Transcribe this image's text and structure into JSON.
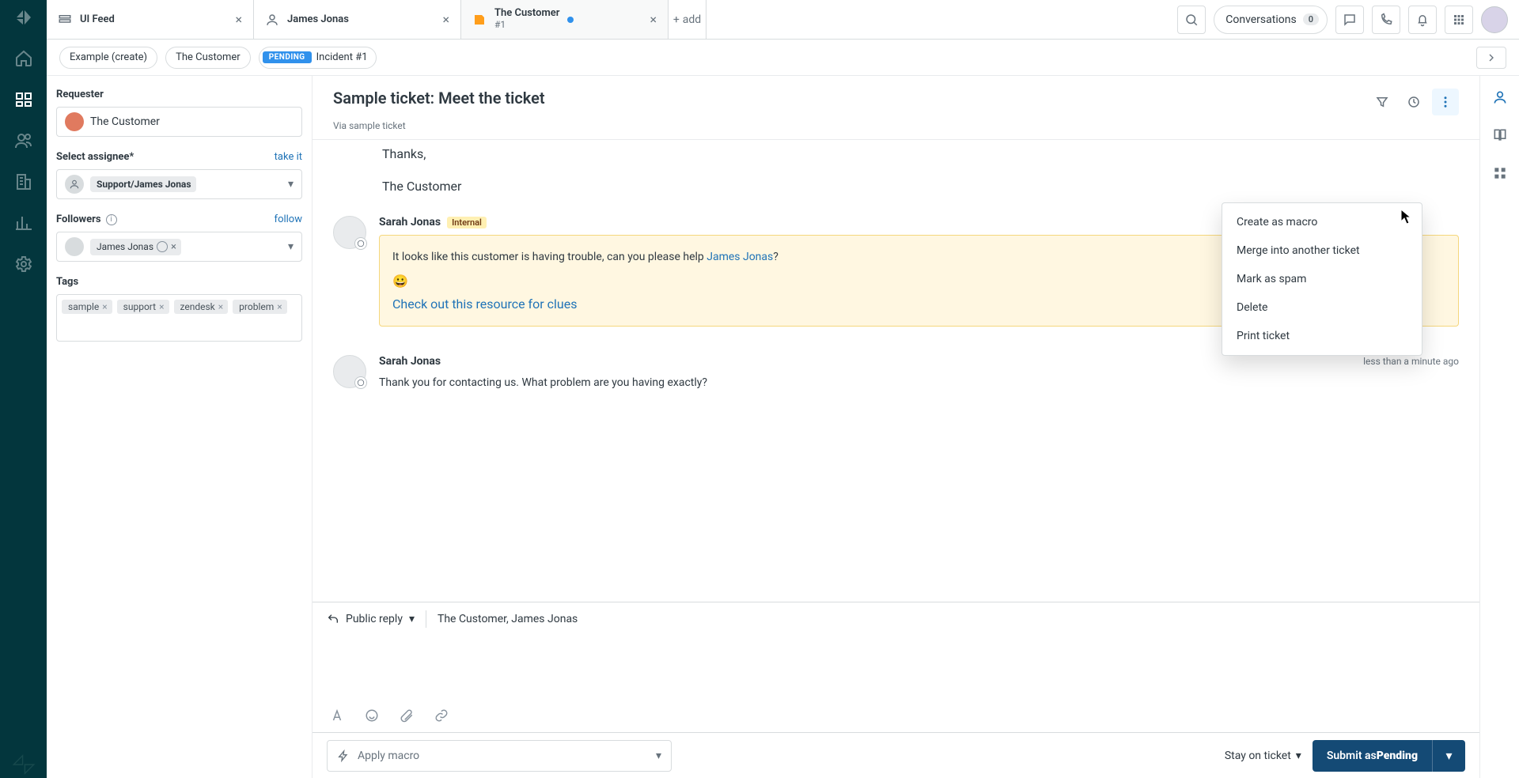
{
  "tabs": [
    {
      "icon": "views",
      "title": "UI Feed",
      "sub": ""
    },
    {
      "icon": "user",
      "title": "James Jonas",
      "sub": ""
    },
    {
      "icon": "ticket",
      "title": "The Customer",
      "sub": "#1",
      "dot": true
    }
  ],
  "add_label": "add",
  "topbar": {
    "conversations_label": "Conversations",
    "conversations_count": "0"
  },
  "breadcrumb": {
    "example": "Example (create)",
    "customer": "The Customer",
    "status_badge": "PENDING",
    "incident": "Incident #1"
  },
  "subject": "Sample ticket: Meet the ticket",
  "via": "Via sample ticket",
  "context_menu": [
    "Create as macro",
    "Merge into another ticket",
    "Mark as spam",
    "Delete",
    "Print ticket"
  ],
  "sidebar": {
    "requester_label": "Requester",
    "requester_name": "The Customer",
    "assignee_label": "Select assignee*",
    "take_it": "take it",
    "assignee_value": "Support/James Jonas",
    "followers_label": "Followers",
    "follow": "follow",
    "follower_chip": "James Jonas",
    "tags_label": "Tags",
    "tags": [
      "sample",
      "support",
      "zendesk",
      "problem"
    ]
  },
  "thread": {
    "prior": {
      "thanks": "Thanks,",
      "sig": "The Customer"
    },
    "msg1": {
      "author": "Sarah Jonas",
      "internal": "Internal",
      "body_pre": "It looks like this customer is having trouble, can you please help ",
      "body_link": "James Jonas",
      "body_post": "?",
      "emoji": "😀",
      "clue": "Check out this resource for clues"
    },
    "msg2": {
      "author": "Sarah Jonas",
      "ts": "less than a minute ago",
      "body": "Thank you for contacting us. What problem are you having exactly?"
    }
  },
  "reply": {
    "type": "Public reply",
    "to": "The Customer, James Jonas"
  },
  "bottom": {
    "macro": "Apply macro",
    "stay": "Stay on ticket",
    "submit_pre": "Submit as ",
    "submit_state": "Pending"
  }
}
